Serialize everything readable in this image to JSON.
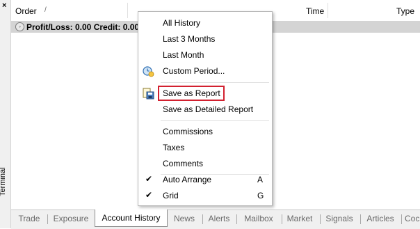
{
  "window": {
    "side_label": "Terminal",
    "close_glyph": "×"
  },
  "header": {
    "order": "Order",
    "sort_glyph": "/",
    "time": "Time",
    "type": "Type"
  },
  "summary": {
    "text": "Profit/Loss: 0.00  Credit: 0.00"
  },
  "menu": {
    "items": [
      {
        "label": "All History"
      },
      {
        "label": "Last 3 Months"
      },
      {
        "label": "Last Month"
      },
      {
        "label": "Custom Period...",
        "icon": "calendar-clock-icon"
      },
      {
        "label": "Save as Report",
        "icon": "save-report-icon",
        "highlighted": true
      },
      {
        "label": "Save as Detailed Report"
      },
      {
        "label": "Commissions"
      },
      {
        "label": "Taxes"
      },
      {
        "label": "Comments"
      },
      {
        "label": "Auto Arrange",
        "checked": true,
        "shortcut": "A"
      },
      {
        "label": "Grid",
        "checked": true,
        "shortcut": "G"
      }
    ],
    "check_glyph": "✔",
    "highlight_color": "#d2202f"
  },
  "tabs": [
    "Trade",
    "Exposure",
    "Account History",
    "News",
    "Alerts",
    "Mailbox",
    "Market",
    "Signals",
    "Articles",
    "Coc"
  ],
  "active_tab": "Account History"
}
